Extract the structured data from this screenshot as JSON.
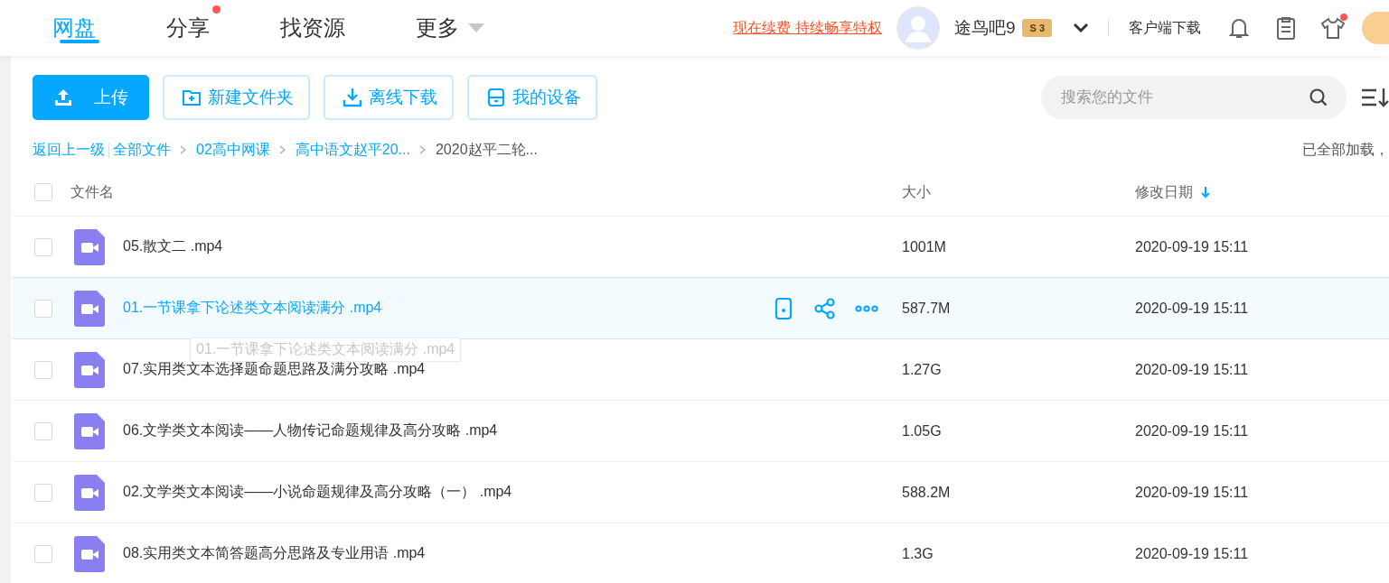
{
  "nav": {
    "tabs": [
      {
        "label": "网盘",
        "selected": true,
        "dot": false,
        "dropdown": false
      },
      {
        "label": "分享",
        "selected": false,
        "dot": true,
        "dropdown": false
      },
      {
        "label": "找资源",
        "selected": false,
        "dot": false,
        "dropdown": false
      },
      {
        "label": "更多",
        "selected": false,
        "dot": false,
        "dropdown": true
      }
    ],
    "promo": "现在续费 持续畅享特权",
    "user": "途鸟吧9",
    "tier": "S",
    "level": "3",
    "client": "客户端下载"
  },
  "toolbar": {
    "buttons": [
      {
        "label": "上传",
        "kind": "upload"
      },
      {
        "label": "新建文件夹",
        "kind": "folder"
      },
      {
        "label": "离线下载",
        "kind": "download"
      },
      {
        "label": "我的设备",
        "kind": "device"
      }
    ],
    "search": {
      "placeholder": "搜索您的文件"
    }
  },
  "breadcrumb": {
    "back": "返回上一级",
    "items": [
      {
        "label": "全部文件",
        "current": false
      },
      {
        "label": "02高中网课",
        "current": false
      },
      {
        "label": "高中语文赵平20...",
        "current": false
      },
      {
        "label": "2020赵平二轮...",
        "current": true
      }
    ],
    "status": "已全部加载，"
  },
  "table": {
    "all_checked": false,
    "columns": [
      "文件名",
      "大小",
      "修改日期"
    ],
    "rows": [
      {
        "name": "05.散文二 .mp4",
        "size": "1001M",
        "date": "2020-09-19 15:11",
        "highlighted": false
      },
      {
        "name": "01.一节课拿下论述类文本阅读满分 .mp4",
        "size": "587.7M",
        "date": "2020-09-19 15:11",
        "highlighted": true
      },
      {
        "name": "07.实用类文本选择题命题思路及满分攻略 .mp4",
        "size": "1.27G",
        "date": "2020-09-19 15:11",
        "highlighted": false
      },
      {
        "name": "06.文学类文本阅读——人物传记命题规律及高分攻略 .mp4",
        "size": "1.05G",
        "date": "2020-09-19 15:11",
        "highlighted": false
      },
      {
        "name": "02.文学类文本阅读——小说命题规律及高分攻略（一） .mp4",
        "size": "588.2M",
        "date": "2020-09-19 15:11",
        "highlighted": false
      },
      {
        "name": "08.实用类文本简答题高分思路及专业用语 .mp4",
        "size": "1.3G",
        "date": "2020-09-19 15:11",
        "highlighted": false
      }
    ],
    "tooltip": "01.一节课拿下论述类文本阅读满分 .mp4"
  }
}
